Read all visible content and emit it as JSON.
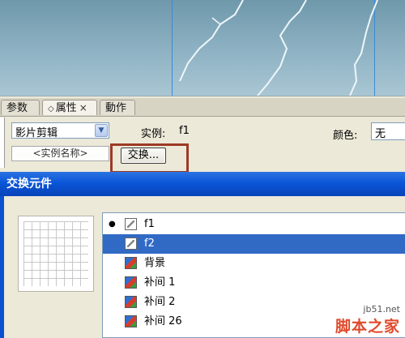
{
  "stage": {
    "guide_color": "#3a8ad6"
  },
  "panel": {
    "tabs": [
      {
        "label": "参数",
        "active": false
      },
      {
        "label": "属性",
        "active": true,
        "close": "×"
      },
      {
        "label": "動作",
        "active": false
      }
    ],
    "symbol_type": "影片剪辑",
    "instance_label": "实例:",
    "instance_value": "f1",
    "color_label": "颜色:",
    "color_value": "无",
    "instance_name_placeholder": "<实例名称>",
    "swap_button": "交换..."
  },
  "dialog": {
    "title": "交换元件",
    "items": [
      {
        "label": "f1",
        "current": true,
        "selected": false,
        "icon": "movieclip-icon"
      },
      {
        "label": "f2",
        "current": false,
        "selected": true,
        "icon": "movieclip-icon"
      },
      {
        "label": "背景",
        "current": false,
        "selected": false,
        "icon": "graphic-icon"
      },
      {
        "label": "补间 1",
        "current": false,
        "selected": false,
        "icon": "graphic-icon"
      },
      {
        "label": "补间 2",
        "current": false,
        "selected": false,
        "icon": "graphic-icon"
      },
      {
        "label": "补间 26",
        "current": false,
        "selected": false,
        "icon": "graphic-icon"
      }
    ]
  },
  "watermark": {
    "site": "jb51.net",
    "brand": "脚本之家"
  },
  "colors": {
    "highlight": "#9c3a26",
    "selection": "#316ac5",
    "titlebar": "#0a55d8"
  }
}
